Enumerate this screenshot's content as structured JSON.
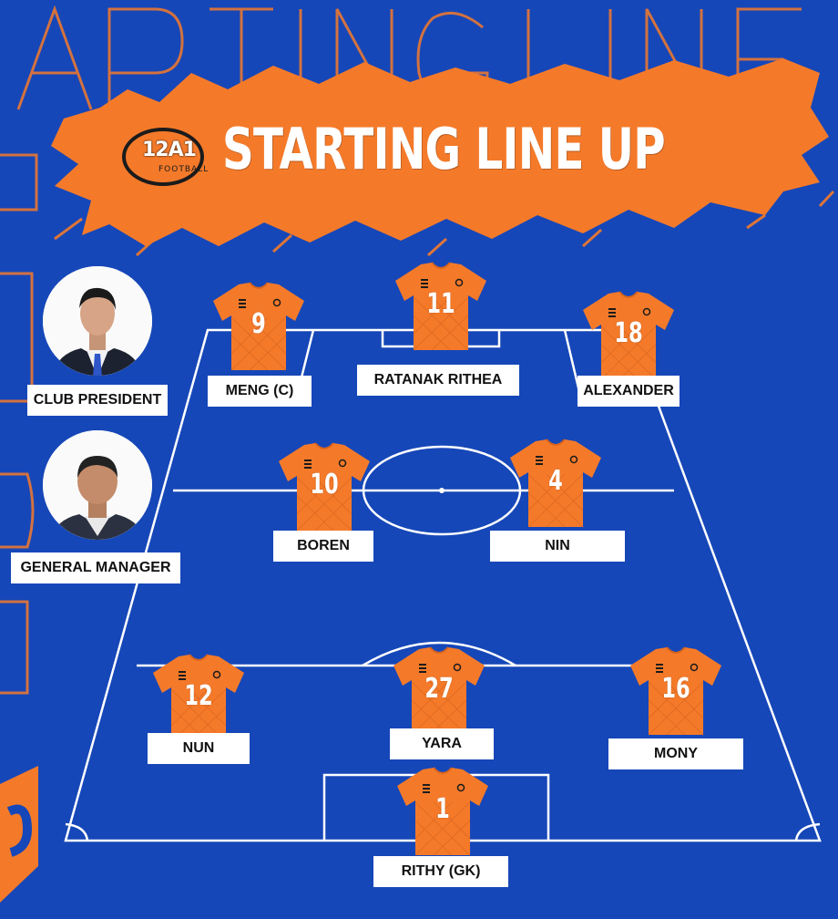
{
  "brand": {
    "mark": "12A1",
    "sub": "FOOTBALL"
  },
  "title": "STARTING LINE UP",
  "staff": [
    {
      "role": "CLUB PRESIDENT",
      "icon": "president-photo"
    },
    {
      "role": "GENERAL MANAGER",
      "icon": "manager-photo"
    }
  ],
  "players": [
    {
      "number": "9",
      "name": "MENG (C)"
    },
    {
      "number": "11",
      "name": "RATANAK RITHEA"
    },
    {
      "number": "18",
      "name": "ALEXANDER"
    },
    {
      "number": "10",
      "name": "BOREN"
    },
    {
      "number": "4",
      "name": "NIN"
    },
    {
      "number": "12",
      "name": "NUN"
    },
    {
      "number": "27",
      "name": "YARA"
    },
    {
      "number": "16",
      "name": "MONY"
    },
    {
      "number": "1",
      "name": "RITHY (GK)"
    }
  ],
  "colors": {
    "background": "#1647b8",
    "accent": "#f47a2a",
    "line": "#ffffff"
  }
}
